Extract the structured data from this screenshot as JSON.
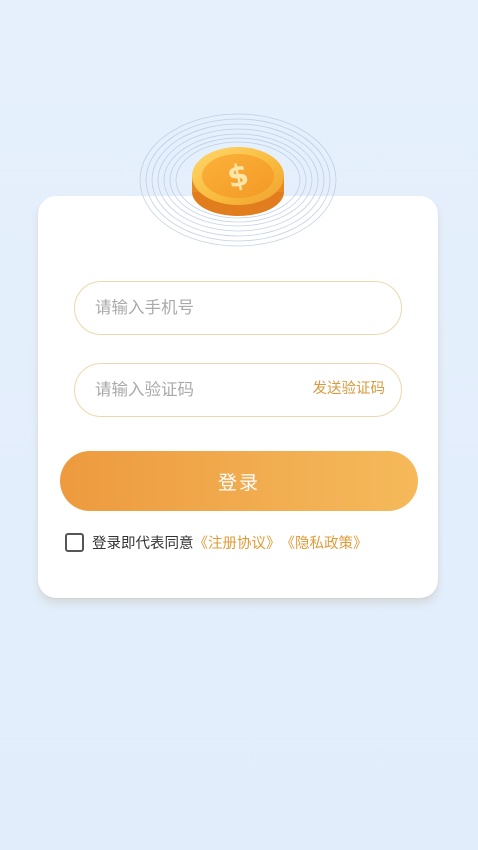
{
  "colors": {
    "background": "#e3eefc",
    "accent": "#f0a445",
    "link": "#e29b39",
    "input_border": "#eed7ad"
  },
  "header": {
    "coin_icon": "dollar-coin-icon"
  },
  "form": {
    "phone": {
      "placeholder": "请输入手机号",
      "value": ""
    },
    "code": {
      "placeholder": "请输入验证码",
      "value": "",
      "send_label": "发送验证码"
    },
    "login_label": "登录"
  },
  "agreement": {
    "checked": false,
    "prefix": "登录即代表同意",
    "terms_label": "《注册协议》",
    "privacy_label": "《隐私政策》"
  }
}
